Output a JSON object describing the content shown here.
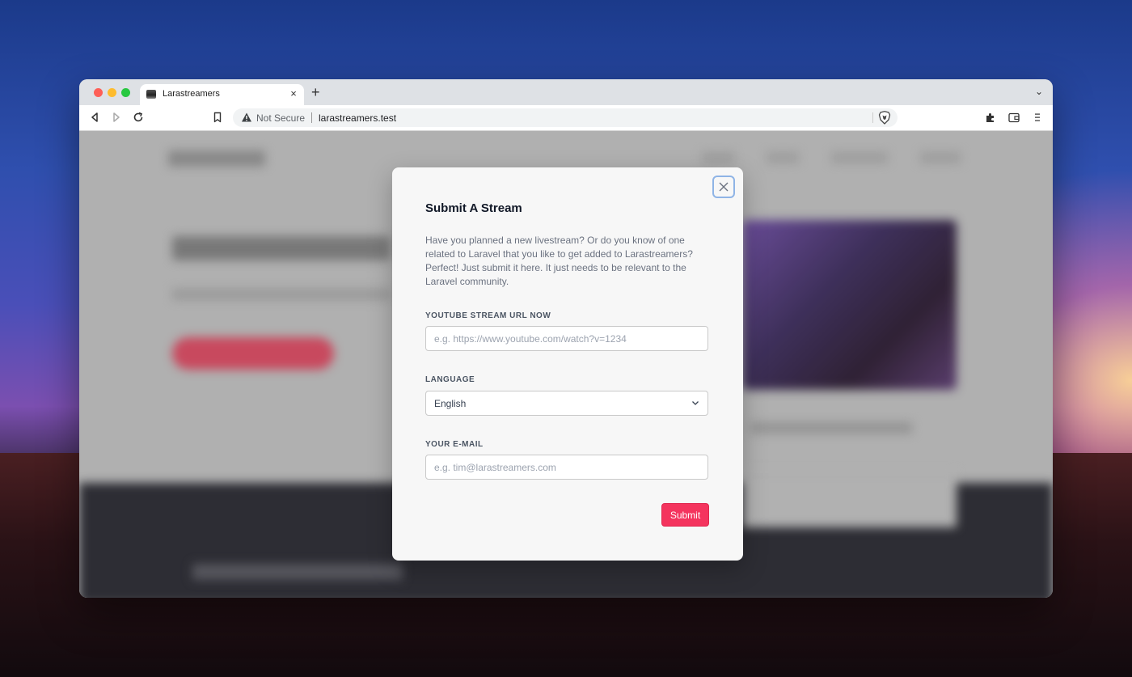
{
  "browser": {
    "tab_title": "Larastreamers",
    "tab_close": "×",
    "new_tab": "+",
    "tab_menu": "⌄",
    "security_label": "Not Secure",
    "url": "larastreamers.test",
    "icons": [
      "back-icon",
      "forward-icon",
      "reload-icon",
      "bookmark-icon",
      "warning-icon",
      "brave-shield-icon",
      "extensions-icon",
      "wallet-icon",
      "menu-icon"
    ]
  },
  "modal": {
    "title": "Submit A Stream",
    "description": "Have you planned a new livestream? Or do you know of one related to Laravel that you like to get added to Larastreamers? Perfect! Just submit it here. It just needs to be relevant to the Laravel community.",
    "youtube_label": "YOUTUBE STREAM URL NOW",
    "youtube_placeholder": "e.g. https://www.youtube.com/watch?v=1234",
    "language_label": "LANGUAGE",
    "language_value": "English",
    "email_label": "YOUR E-MAIL",
    "email_placeholder": "e.g. tim@larastreamers.com",
    "submit_label": "Submit"
  },
  "colors": {
    "accent": "#f4345e",
    "focus_ring": "#8fb4e6"
  }
}
